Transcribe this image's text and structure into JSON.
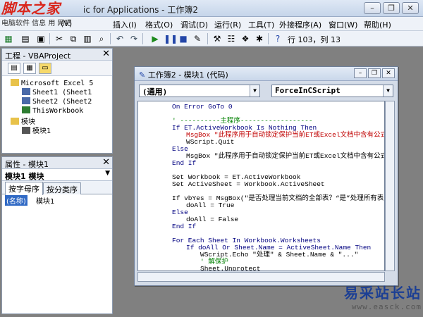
{
  "app": {
    "logo_text": "脚本之家",
    "logo_subtext": "电脑软件 信息 用 网吧",
    "title": "ic for Applications - 工作簿2"
  },
  "menu": [
    "(V)",
    "插入(I)",
    "格式(O)",
    "调试(D)",
    "运行(R)",
    "工具(T)",
    "外接程序(A)",
    "窗口(W)",
    "帮助(H)"
  ],
  "toolbar": {
    "position": "行 103，列 13"
  },
  "project_panel": {
    "title": "工程 - VBAProject",
    "tree": [
      {
        "indent": 0,
        "label": "Microsoft Excel 5",
        "icon": "folder-icon"
      },
      {
        "indent": 1,
        "label": "Sheet1 (Sheet1",
        "icon": "sheet-icon"
      },
      {
        "indent": 1,
        "label": "Sheet2 (Sheet2",
        "icon": "sheet-icon"
      },
      {
        "indent": 1,
        "label": "ThisWorkbook",
        "icon": "workbook-icon"
      },
      {
        "indent": 0,
        "label": "模块",
        "icon": "folder-icon"
      },
      {
        "indent": 1,
        "label": "模块1",
        "icon": "module-icon"
      }
    ]
  },
  "props_panel": {
    "title": "属性 - 模块1",
    "object": "模块1 模块",
    "tabs": [
      "按字母序",
      "按分类序"
    ],
    "row_name": "(名称)",
    "row_value": "模块1"
  },
  "code_window": {
    "title": "工作簿2 - 模块1 (代码)",
    "combo_left": "(通用)",
    "combo_right": "ForceInCScript",
    "lines": [
      {
        "indent": 0,
        "text": "On Error GoTo 0",
        "style": "kw"
      },
      {
        "indent": 0,
        "text": "",
        "style": ""
      },
      {
        "indent": 0,
        "text": "' ----------主程序------------------",
        "style": "cm"
      },
      {
        "indent": 0,
        "text": "If ET.ActiveWorkbook Is Nothing Then",
        "style": "kw"
      },
      {
        "indent": 1,
        "text": "MsgBox \"此程序用于自动锁定保护当前ET或Excel文档中含有公式",
        "style": "red"
      },
      {
        "indent": 1,
        "text": "WScript.Quit",
        "style": ""
      },
      {
        "indent": 0,
        "text": "Else",
        "style": "kw"
      },
      {
        "indent": 1,
        "text": "MsgBox \"此程序用于自动锁定保护当前ET或Excel文档中含有公式",
        "style": ""
      },
      {
        "indent": 0,
        "text": "End If",
        "style": "kw"
      },
      {
        "indent": 0,
        "text": "",
        "style": ""
      },
      {
        "indent": 0,
        "text": "Set Workbook = ET.ActiveWorkbook",
        "style": ""
      },
      {
        "indent": 0,
        "text": "Set ActiveSheet = Workbook.ActiveSheet",
        "style": ""
      },
      {
        "indent": 0,
        "text": "",
        "style": ""
      },
      {
        "indent": 0,
        "text": "If vbYes = MsgBox(\"是否处理当前文档的全部表？“是”处理所有表",
        "style": ""
      },
      {
        "indent": 1,
        "text": "doAll = True",
        "style": ""
      },
      {
        "indent": 0,
        "text": "Else",
        "style": "kw"
      },
      {
        "indent": 1,
        "text": "doAll = False",
        "style": ""
      },
      {
        "indent": 0,
        "text": "End If",
        "style": "kw"
      },
      {
        "indent": 0,
        "text": "",
        "style": ""
      },
      {
        "indent": 0,
        "text": "For Each Sheet In Workbook.Worksheets",
        "style": "kw"
      },
      {
        "indent": 1,
        "text": "If doAll Or Sheet.Name = ActiveSheet.Name Then",
        "style": "kw"
      },
      {
        "indent": 2,
        "text": "WScript.Echo \"处理\" & Sheet.Name & \"...\"",
        "style": ""
      },
      {
        "indent": 2,
        "text": "' 解保护",
        "style": "cm"
      },
      {
        "indent": 2,
        "text": "Sheet.Unprotect",
        "style": ""
      }
    ]
  },
  "watermark": {
    "cn": "易采站长站",
    "url": "www.easck.com"
  }
}
